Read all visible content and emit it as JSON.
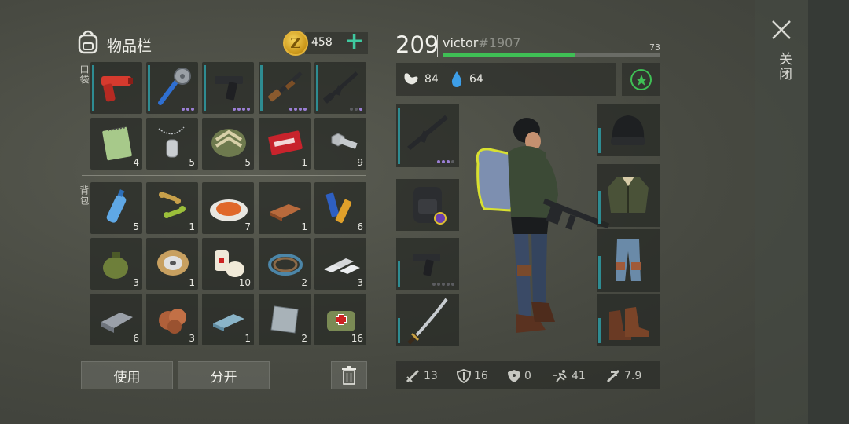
{
  "header": {
    "inventory_title": "物品栏",
    "coin_symbol": "Z",
    "coin_count": "458",
    "add_symbol": "+"
  },
  "sections": {
    "pocket_label": "口袋",
    "backpack_label": "背包"
  },
  "pocket_items": [
    {
      "name": "flare-gun",
      "count": "",
      "quality_dots": 0
    },
    {
      "name": "spiked-bat",
      "count": "",
      "quality_dots": 3
    },
    {
      "name": "pistol",
      "count": "",
      "quality_dots": 4
    },
    {
      "name": "shotgun",
      "count": "",
      "quality_dots": 4
    },
    {
      "name": "assault-rifle",
      "count": "",
      "quality_dots": 1
    },
    {
      "name": "notebook",
      "count": "4"
    },
    {
      "name": "dog-tags",
      "count": "5"
    },
    {
      "name": "rank-chevron-patch",
      "count": "5"
    },
    {
      "name": "combat-gear-coupon",
      "count": "1"
    },
    {
      "name": "bolts-and-nuts",
      "count": "9"
    }
  ],
  "backpack_items": [
    {
      "name": "water-bottle",
      "count": "5"
    },
    {
      "name": "dog-treats",
      "count": "1"
    },
    {
      "name": "food-plate",
      "count": "7"
    },
    {
      "name": "copper-ingot",
      "count": "1"
    },
    {
      "name": "batteries",
      "count": "6"
    },
    {
      "name": "grenade",
      "count": "3"
    },
    {
      "name": "wire-spool",
      "count": "1"
    },
    {
      "name": "bandages",
      "count": "10"
    },
    {
      "name": "rope-coil",
      "count": "2"
    },
    {
      "name": "silver-bars",
      "count": "3"
    },
    {
      "name": "iron-ingot",
      "count": "6"
    },
    {
      "name": "ore-chunk",
      "count": "3"
    },
    {
      "name": "aluminum-bar",
      "count": "1"
    },
    {
      "name": "metal-plate",
      "count": "2"
    },
    {
      "name": "medical-bag",
      "count": "16"
    }
  ],
  "buttons": {
    "use_label": "使用",
    "split_label": "分开"
  },
  "player": {
    "level": "209",
    "name": "victor",
    "tag": "#1907",
    "xp_value": "73",
    "xp_fill_fraction": 0.61
  },
  "needs": {
    "hunger": "84",
    "water": "64"
  },
  "character_stats": {
    "attack": "13",
    "defense": "16",
    "radiation": "0",
    "speed": "41",
    "damage": "7.9"
  },
  "close": {
    "close_label": "关闭"
  },
  "colors": {
    "accent_teal": "#2e8c92",
    "xp_green": "#3fbf55",
    "plus_teal": "#3fc9a0",
    "coin_gold": "#e3b43a",
    "quality_purple": "#9b7fd6"
  }
}
